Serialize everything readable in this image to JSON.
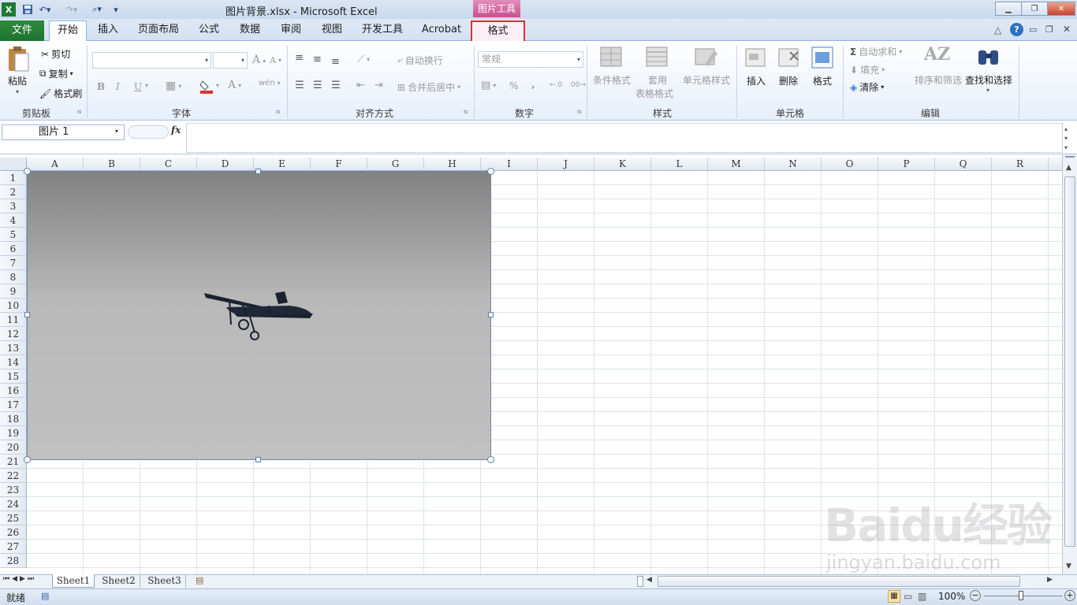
{
  "window": {
    "title": "图片背景.xlsx  -  Microsoft Excel",
    "contextual_group": "图片工具"
  },
  "tabs": [
    "文件",
    "开始",
    "插入",
    "页面布局",
    "公式",
    "数据",
    "审阅",
    "视图",
    "开发工具",
    "Acrobat",
    "格式"
  ],
  "ribbon": {
    "clipboard": {
      "paste": "粘贴",
      "cut": "剪切",
      "copy": "复制",
      "format_painter": "格式刷",
      "label": "剪贴板"
    },
    "font": {
      "label": "字体",
      "bold": "B",
      "italic": "I",
      "underline": "U",
      "grow": "A",
      "shrink": "A",
      "font_color": "A",
      "phonetic": "wén"
    },
    "alignment": {
      "wrap": "自动换行",
      "merge": "合并后居中",
      "label": "对齐方式"
    },
    "number": {
      "format": "常规",
      "percent": "%",
      "comma": ",",
      "label": "数字"
    },
    "styles": {
      "conditional": "条件格式",
      "table_line1": "套用",
      "table_line2": "表格格式",
      "cell_styles": "单元格样式",
      "label": "样式"
    },
    "cells": {
      "insert": "插入",
      "delete": "删除",
      "format": "格式",
      "label": "单元格"
    },
    "editing": {
      "autosum": "自动求和",
      "fill": "填充",
      "clear": "清除",
      "sort": "排序和筛选",
      "find": "查找和选择",
      "label": "编辑",
      "sigma": "Σ"
    }
  },
  "formula_bar": {
    "name_box": "图片  1",
    "fx": "fx"
  },
  "columns": [
    "A",
    "B",
    "C",
    "D",
    "E",
    "F",
    "G",
    "H",
    "I",
    "J",
    "K",
    "L",
    "M",
    "N",
    "O",
    "P",
    "Q",
    "R"
  ],
  "rows": [
    "1",
    "2",
    "3",
    "4",
    "5",
    "6",
    "7",
    "8",
    "9",
    "10",
    "11",
    "12",
    "13",
    "14",
    "15",
    "16",
    "17",
    "18",
    "19",
    "20",
    "21",
    "22",
    "23",
    "24",
    "25",
    "26",
    "27",
    "28"
  ],
  "sheets": [
    "Sheet1",
    "Sheet2",
    "Sheet3"
  ],
  "status": {
    "ready": "就绪",
    "zoom": "100%"
  },
  "watermark": {
    "main": "Baidu经验",
    "sub": "jingyan.baidu.com"
  },
  "colors": {
    "file_tab": "#1d7331",
    "highlight": "#e03030",
    "context": "#c8508f"
  }
}
